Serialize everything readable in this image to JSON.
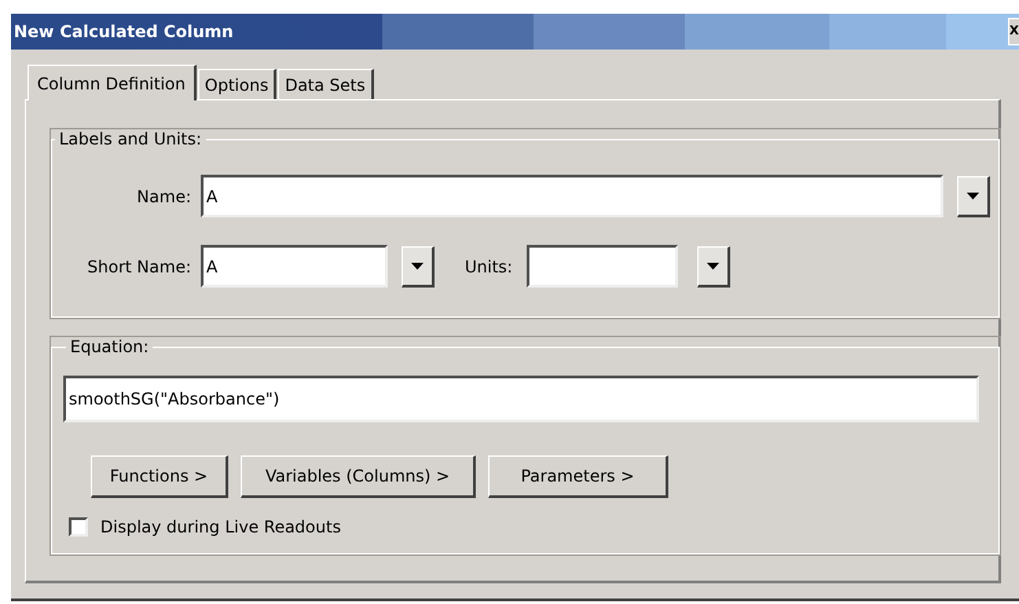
{
  "window": {
    "title": "New Calculated Column",
    "close": "X"
  },
  "tabs": [
    {
      "label": "Column Definition",
      "selected": true
    },
    {
      "label": "Options",
      "selected": false
    },
    {
      "label": "Data Sets",
      "selected": false
    }
  ],
  "labels_group": {
    "title": "Labels and Units:",
    "name": {
      "label": "Name:",
      "value": "A"
    },
    "short_name": {
      "label": "Short Name:",
      "value": "A"
    },
    "units": {
      "label": "Units:"
    }
  },
  "equation_group": {
    "title": "Equation:",
    "value": "smoothSG(\"Absorbance\")",
    "buttons": [
      "Functions >",
      "Variables (Columns) >",
      "Parameters >"
    ],
    "checkbox": {
      "label": "Display during Live Readouts",
      "checked": false
    }
  }
}
